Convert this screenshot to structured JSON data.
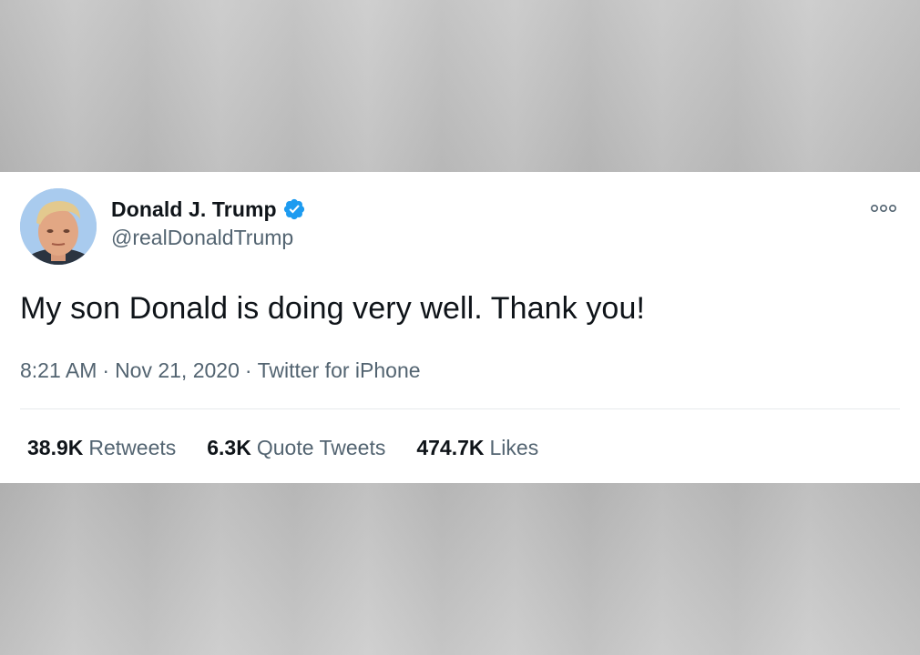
{
  "tweet": {
    "display_name": "Donald J. Trump",
    "handle": "@realDonaldTrump",
    "verified": true,
    "text": "My son Donald is doing very well. Thank you!",
    "time": "8:21 AM",
    "date": "Nov 21, 2020",
    "source": "Twitter for iPhone",
    "separator": "·",
    "stats": {
      "retweets_count": "38.9K",
      "retweets_label": "Retweets",
      "quote_tweets_count": "6.3K",
      "quote_tweets_label": "Quote Tweets",
      "likes_count": "474.7K",
      "likes_label": "Likes"
    }
  },
  "icons": {
    "verified": "verified-badge-icon",
    "more": "more-options-icon"
  },
  "colors": {
    "verified_blue": "#1d9bf0",
    "text_primary": "#0f1419",
    "text_secondary": "#536471",
    "background_card": "#ffffff",
    "background_outer": "#c4c4c4"
  }
}
